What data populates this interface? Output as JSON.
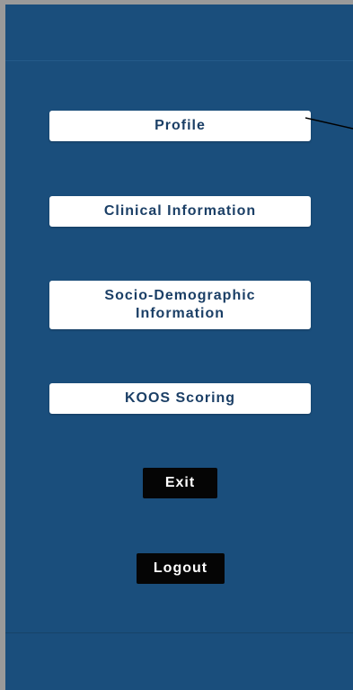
{
  "menu": {
    "profile": "Profile",
    "clinical": "Clinical Information",
    "socio_line1": "Socio-Demographic",
    "socio_line2": "Information",
    "koos": "KOOS Scoring"
  },
  "actions": {
    "exit": "Exit",
    "logout": "Logout"
  },
  "colors": {
    "background": "#1a4e7c",
    "button_text": "#1b3f66",
    "dark_button": "#050505"
  }
}
